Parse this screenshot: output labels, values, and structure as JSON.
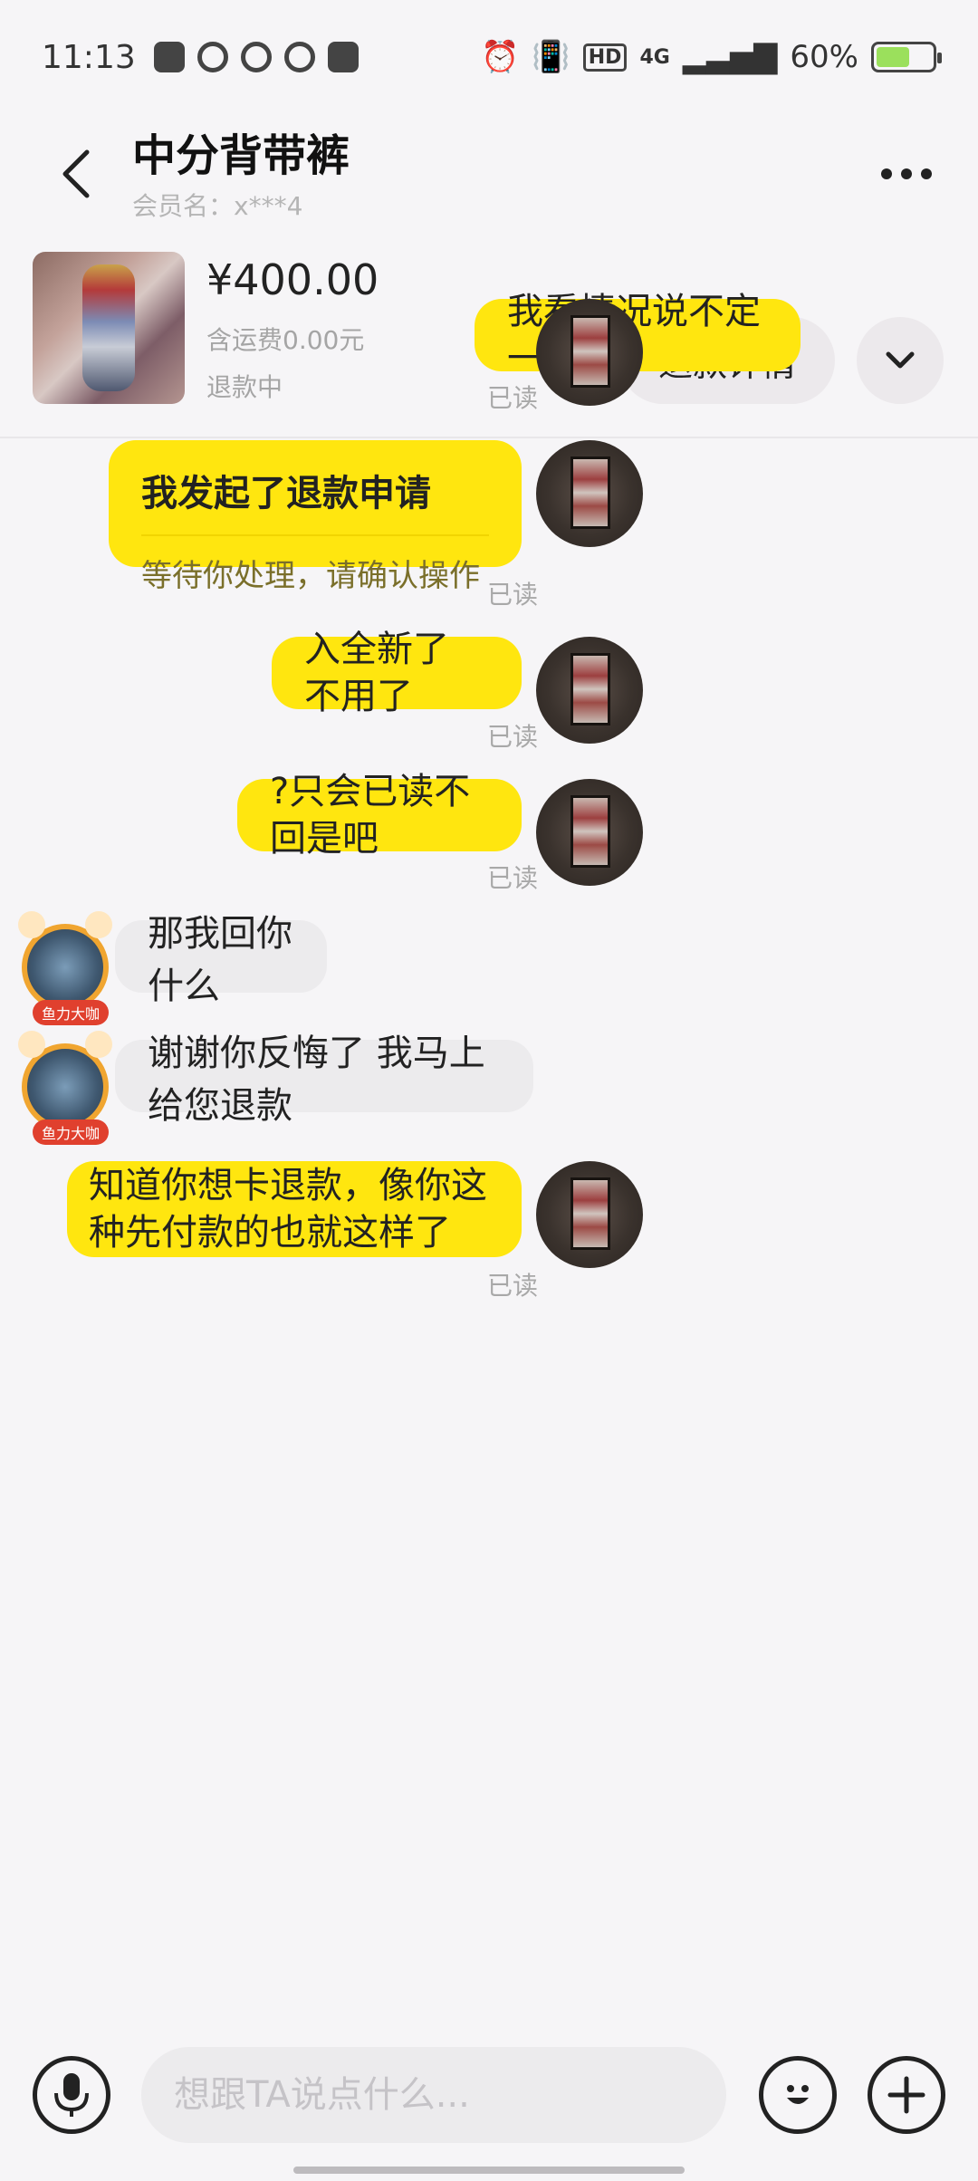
{
  "status_bar": {
    "time": "11:13",
    "network": "4G",
    "battery_percent": "60%",
    "battery_level": 0.6
  },
  "header": {
    "title": "中分背带裤",
    "member_label": "会员名：x***4",
    "back_icon": "chevron-left-icon",
    "more_icon": "more-dots-icon"
  },
  "product": {
    "price": "¥400.00",
    "shipping": "含运费0.00元",
    "status": "退款中",
    "refund_button": "退款详情",
    "expand_icon": "chevron-down-icon"
  },
  "messages": [
    {
      "sender": "me",
      "text": "我看情况说不定一起收",
      "read": "已读"
    },
    {
      "sender": "me",
      "type": "refund-card",
      "title": "我发起了退款申请",
      "subtitle": "等待你处理，请确认操作",
      "read": "已读"
    },
    {
      "sender": "me",
      "text": "入全新了 不用了",
      "read": "已读"
    },
    {
      "sender": "me",
      "text": "?只会已读不回是吧",
      "read": "已读"
    },
    {
      "sender": "other",
      "text": "那我回你什么",
      "badge": "鱼力大咖"
    },
    {
      "sender": "other",
      "text": "谢谢你反悔了 我马上给您退款",
      "badge": "鱼力大咖"
    },
    {
      "sender": "me",
      "text": "知道你想卡退款，像你这种先付款的也就这样了",
      "read": "已读"
    }
  ],
  "input_bar": {
    "placeholder": "想跟TA说点什么...",
    "mic_icon": "microphone-icon",
    "emoji_icon": "emoji-icon",
    "plus_icon": "plus-icon"
  },
  "colors": {
    "my_bubble": "#ffe60f",
    "other_bubble": "#ecebed",
    "background": "#f6f5f7"
  }
}
